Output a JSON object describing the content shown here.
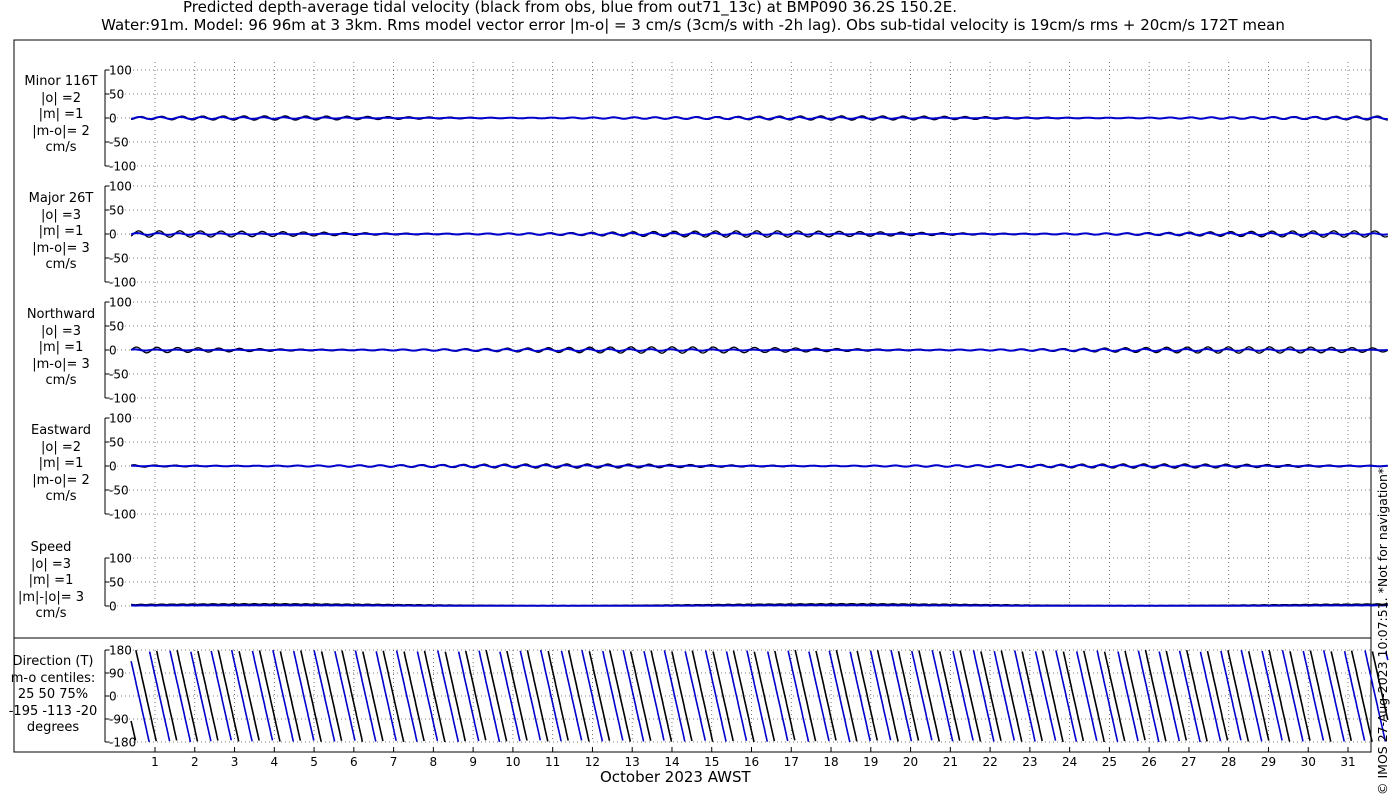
{
  "header": {
    "title_line1": "Predicted depth-average tidal velocity (black from obs, blue from out71_13c) at BMP090 36.2S 150.2E.",
    "title_line2": "Water:91m. Model: 96 96m at 3 3km. Rms model vector error |m-o| = 3 cm/s (3cm/s with -2h lag). Obs sub-tidal velocity is 19cm/s rms + 20cm/s 172T mean"
  },
  "panels": [
    {
      "lines": [
        "Minor 116T",
        "|o| =2",
        "|m| =1",
        "|m-o|= 2",
        "cm/s"
      ]
    },
    {
      "lines": [
        "Major 26T",
        "|o| =3",
        "|m| =1",
        "|m-o|= 3",
        "cm/s"
      ]
    },
    {
      "lines": [
        "Northward",
        "|o| =3",
        "|m| =1",
        "|m-o|= 3",
        "cm/s"
      ]
    },
    {
      "lines": [
        "Eastward",
        "|o| =2",
        "|m| =1",
        "|m-o|= 2",
        "cm/s"
      ]
    },
    {
      "lines": [
        "Speed",
        "|o| =3",
        "|m| =1",
        "|m|-|o|= 3",
        "cm/s"
      ]
    },
    {
      "lines": [
        "Direction (T)",
        "m-o centiles:",
        "25  50  75%",
        "-195 -113  -20",
        "degrees"
      ]
    }
  ],
  "footer": {
    "xaxis_title": "October 2023 AWST",
    "copyright": "© IMOS 27-Aug-2023 10:07:51. *Not for navigation*"
  },
  "colors": {
    "obs": "#000000",
    "model": "#0000cc",
    "grid": "#555555"
  },
  "chart_data": {
    "type": "line",
    "x_unit": "day of October 2023 (AWST)",
    "xlim": [
      0,
      32
    ],
    "xticks": [
      "1",
      "2",
      "3",
      "4",
      "5",
      "6",
      "7",
      "8",
      "9",
      "10",
      "11",
      "12",
      "13",
      "14",
      "15",
      "16",
      "17",
      "18",
      "19",
      "20",
      "21",
      "22",
      "23",
      "24",
      "25",
      "26",
      "27",
      "28",
      "29",
      "30",
      "31"
    ],
    "subplots": [
      {
        "name": "Minor 116T",
        "ylim": [
          -100,
          100
        ],
        "yticks": [
          "100",
          "50",
          "0",
          "-50",
          "-100"
        ],
        "series": [
          {
            "name": "obs",
            "amplitude": 2
          },
          {
            "name": "model",
            "amplitude": 1
          }
        ]
      },
      {
        "name": "Major 26T",
        "ylim": [
          -100,
          100
        ],
        "yticks": [
          "100",
          "50",
          "0",
          "-50",
          "-100"
        ],
        "series": [
          {
            "name": "obs",
            "amplitude": 3
          },
          {
            "name": "model",
            "amplitude": 1
          }
        ]
      },
      {
        "name": "Northward",
        "ylim": [
          -100,
          100
        ],
        "yticks": [
          "100",
          "50",
          "0",
          "-50",
          "-100"
        ],
        "series": [
          {
            "name": "obs",
            "amplitude": 3
          },
          {
            "name": "model",
            "amplitude": 1
          }
        ]
      },
      {
        "name": "Eastward",
        "ylim": [
          -100,
          100
        ],
        "yticks": [
          "100",
          "50",
          "0",
          "-50",
          "-100"
        ],
        "series": [
          {
            "name": "obs",
            "amplitude": 2
          },
          {
            "name": "model",
            "amplitude": 1
          }
        ]
      },
      {
        "name": "Speed",
        "ylim": [
          0,
          100
        ],
        "yticks": [
          "100",
          "50",
          "0"
        ],
        "series": [
          {
            "name": "obs",
            "mean": 3
          },
          {
            "name": "model",
            "mean": 1
          }
        ]
      },
      {
        "name": "Direction (T)",
        "ylim": [
          -180,
          180
        ],
        "yticks": [
          "180",
          "90",
          "0",
          "-90",
          "-180"
        ],
        "series": [
          {
            "name": "obs",
            "cycles_per_day": 1.93
          },
          {
            "name": "model",
            "cycles_per_day": 1.93
          }
        ]
      }
    ]
  }
}
